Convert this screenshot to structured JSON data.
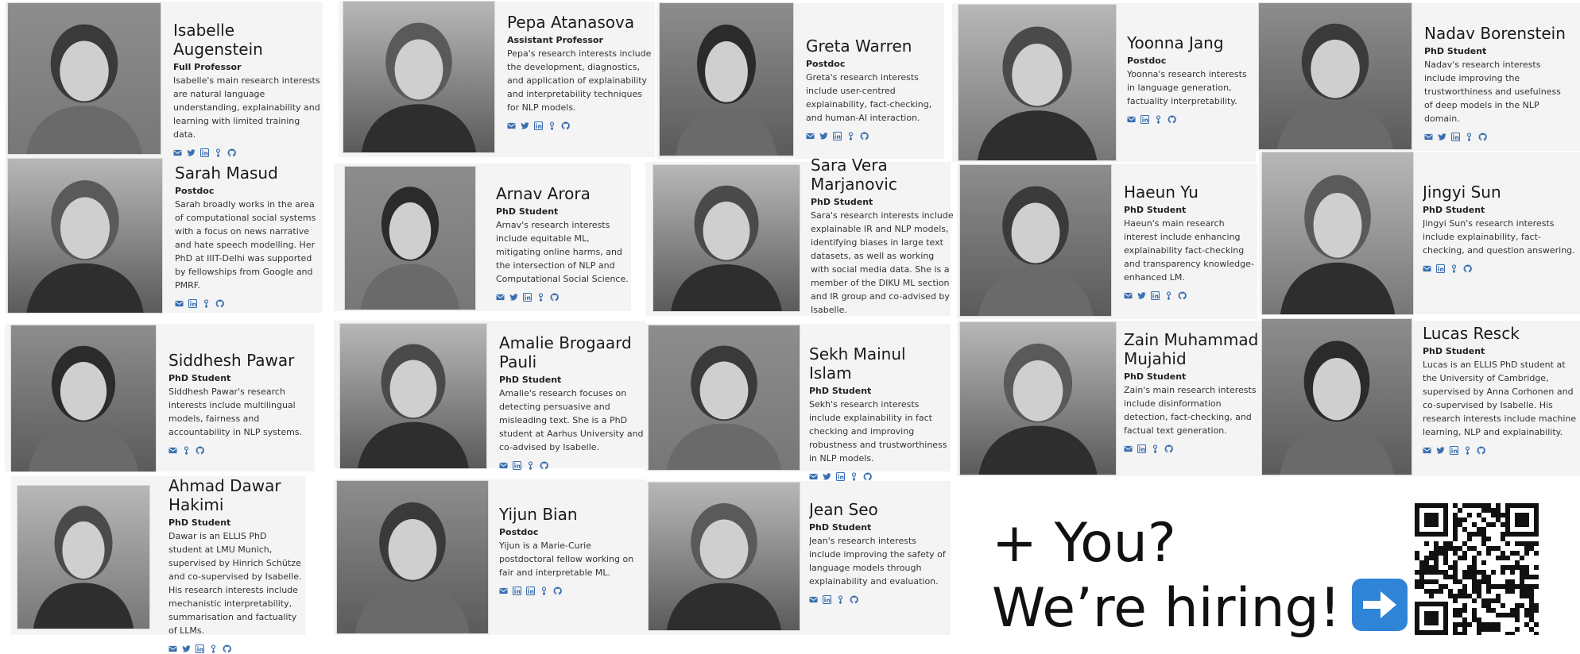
{
  "members": [
    {
      "name": "Isabelle Augenstein",
      "role": "Full Professor",
      "desc": "Isabelle's main research interests are natural language understanding, explainability and learning with limited training data.",
      "icons": [
        "email-icon",
        "twitter-icon",
        "linkedin-icon",
        "scholar-icon",
        "github-icon"
      ]
    },
    {
      "name": "Pepa Atanasova",
      "role": "Assistant Professor",
      "desc": "Pepa's research interests include the development, diagnostics, and application of explainability and interpretability techniques for NLP models.",
      "icons": [
        "email-icon",
        "twitter-icon",
        "linkedin-icon",
        "scholar-icon",
        "github-icon"
      ]
    },
    {
      "name": "Greta Warren",
      "role": "Postdoc",
      "desc": "Greta's research interests include user-centred explainability, fact-checking, and human-AI interaction.",
      "icons": [
        "email-icon",
        "twitter-icon",
        "linkedin-icon",
        "scholar-icon",
        "github-icon"
      ]
    },
    {
      "name": "Yoonna Jang",
      "role": "Postdoc",
      "desc": "Yoonna's research interests in language generation, factuality interpretability.",
      "icons": [
        "email-icon",
        "linkedin-icon",
        "scholar-icon",
        "github-icon"
      ]
    },
    {
      "name": "Nadav Borenstein",
      "role": "PhD Student",
      "desc": "Nadav's research interests include improving the trustworthiness and usefulness of deep models in the NLP domain.",
      "icons": [
        "email-icon",
        "twitter-icon",
        "linkedin-icon",
        "scholar-icon",
        "github-icon"
      ]
    },
    {
      "name": "Sarah Masud",
      "role": "Postdoc",
      "desc": "Sarah broadly works in the area of computational social systems with a focus on news narrative and hate speech modelling. Her PhD at IIIT-Delhi was supported by fellowships from Google and PMRF.",
      "icons": [
        "email-icon",
        "linkedin-icon",
        "scholar-icon",
        "github-icon"
      ]
    },
    {
      "name": "Arnav Arora",
      "role": "PhD Student",
      "desc": "Arnav's research interests include equitable ML, mitigating online harms, and the intersection of NLP and Computational Social Science.",
      "icons": [
        "email-icon",
        "twitter-icon",
        "linkedin-icon",
        "scholar-icon",
        "github-icon"
      ]
    },
    {
      "name": "Sara Vera Marjanovic",
      "role": "PhD Student",
      "desc": "Sara's research interests include explainable IR and NLP models, identifying biases in large text datasets, as well as working with social media data. She is a member of the DIKU ML section and IR group and co-advised by Isabelle.",
      "icons": [
        "email-icon",
        "linkedin-icon",
        "scholar-icon",
        "github-icon"
      ]
    },
    {
      "name": "Haeun Yu",
      "role": "PhD Student",
      "desc": "Haeun's main research interest include enhancing explainability fact-checking and transparency knowledge-enhanced LM.",
      "icons": [
        "email-icon",
        "twitter-icon",
        "linkedin-icon",
        "scholar-icon",
        "github-icon"
      ]
    },
    {
      "name": "Jingyi Sun",
      "role": "PhD Student",
      "desc": "Jingyi Sun's research interests include explainability, fact-checking, and question answering.",
      "icons": [
        "email-icon",
        "linkedin-icon",
        "scholar-icon",
        "github-icon"
      ]
    },
    {
      "name": "Siddhesh Pawar",
      "role": "PhD Student",
      "desc": "Siddhesh Pawar's research interests include multilingual models, fairness and accountability in NLP systems.",
      "icons": [
        "email-icon",
        "scholar-icon",
        "github-icon"
      ]
    },
    {
      "name": "Amalie Brogaard Pauli",
      "role": "PhD Student",
      "desc": "Amalie's research focuses on detecting persuasive and misleading text. She is a PhD student at Aarhus University and co-advised by Isabelle.",
      "icons": [
        "email-icon",
        "linkedin-icon",
        "scholar-icon",
        "github-icon"
      ]
    },
    {
      "name": "Sekh Mainul Islam",
      "role": "PhD Student",
      "desc": "Sekh's research interests include explainability in fact checking and improving robustness and trustworthiness in NLP models.",
      "icons": [
        "email-icon",
        "twitter-icon",
        "linkedin-icon",
        "scholar-icon",
        "github-icon"
      ]
    },
    {
      "name": "Zain Muhammad Mujahid",
      "role": "PhD Student",
      "desc": "Zain's main research interests include disinformation detection, fact-checking, and factual text generation.",
      "icons": [
        "email-icon",
        "linkedin-icon",
        "scholar-icon",
        "github-icon"
      ]
    },
    {
      "name": "Lucas Resck",
      "role": "PhD Student",
      "desc": "Lucas is an ELLIS PhD student at the University of Cambridge, supervised by Anna Corhonen and co-supervised by Isabelle. His research interests include machine learning, NLP and explainability.",
      "icons": [
        "email-icon",
        "twitter-icon",
        "linkedin-icon",
        "scholar-icon",
        "github-icon"
      ]
    },
    {
      "name": "Ahmad Dawar Hakimi",
      "role": "PhD Student",
      "desc": "Dawar is an ELLIS PhD student at LMU Munich, supervised by Hinrich Schütze and co-supervised by Isabelle. His research interests include mechanistic interpretability, summarisation and factuality of LLMs.",
      "icons": [
        "email-icon",
        "twitter-icon",
        "linkedin-icon",
        "scholar-icon",
        "github-icon"
      ]
    },
    {
      "name": "Yijun Bian",
      "role": "Postdoc",
      "desc": "Yijun is a Marie-Curie postdoctoral fellow working on fair and interpretable ML.",
      "icons": [
        "email-icon",
        "linkedin-icon",
        "linkedin-icon",
        "scholar-icon",
        "github-icon"
      ]
    },
    {
      "name": "Jean Seo",
      "role": "PhD Student",
      "desc": "Jean's research interests include improving the safety of language models through explainability and evaluation.",
      "icons": [
        "email-icon",
        "linkedin-icon",
        "scholar-icon",
        "github-icon"
      ]
    }
  ],
  "hiring": {
    "line1": "+ You?",
    "line2": "We’re hiring!",
    "arrow_icon": "right-arrow-icon"
  },
  "qr": {
    "icon": "qr-code-icon"
  },
  "colors": {
    "icon": "#3a6fb0",
    "card_bg": "#f4f4f4"
  }
}
